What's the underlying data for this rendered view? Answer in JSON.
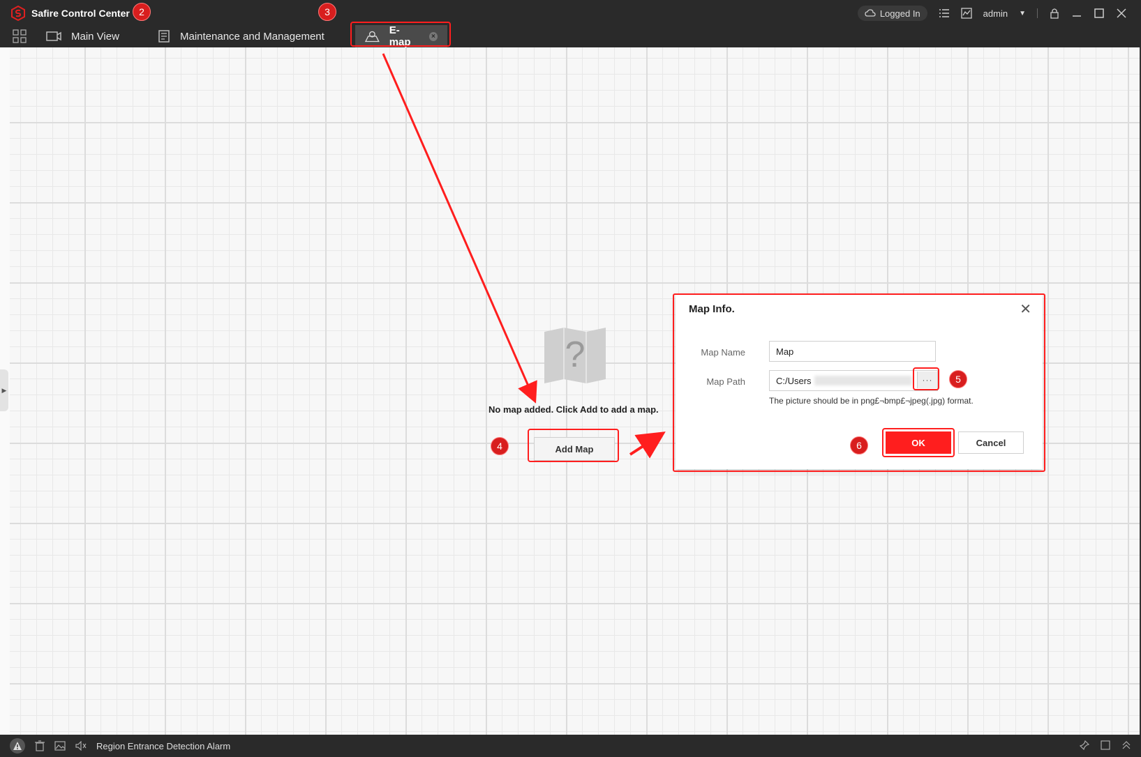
{
  "app": {
    "title": "Safire Control Center"
  },
  "header": {
    "logged_in": "Logged In",
    "user": "admin"
  },
  "tabs": [
    {
      "label": "Main View"
    },
    {
      "label": "Maintenance and Management"
    },
    {
      "label": "E-map",
      "active": true
    }
  ],
  "steps": {
    "s2": "2",
    "s3": "3",
    "s4": "4",
    "s5": "5",
    "s6": "6"
  },
  "canvas": {
    "empty_message": "No map added. Click Add to add a map.",
    "add_map_label": "Add Map"
  },
  "dialog": {
    "title": "Map Info.",
    "map_name_label": "Map Name",
    "map_name_value": "Map",
    "map_path_label": "Map Path",
    "map_path_value": "C:/Users",
    "browse_label": "···",
    "hint": "The picture should be in png£¬bmp£¬jpeg(.jpg) format.",
    "ok_label": "OK",
    "cancel_label": "Cancel"
  },
  "statusbar": {
    "alarm_text": "Region Entrance Detection Alarm"
  },
  "colors": {
    "accent": "#ff1e1e",
    "titlebar": "#2a2a2a",
    "badge": "#d81e1e"
  }
}
